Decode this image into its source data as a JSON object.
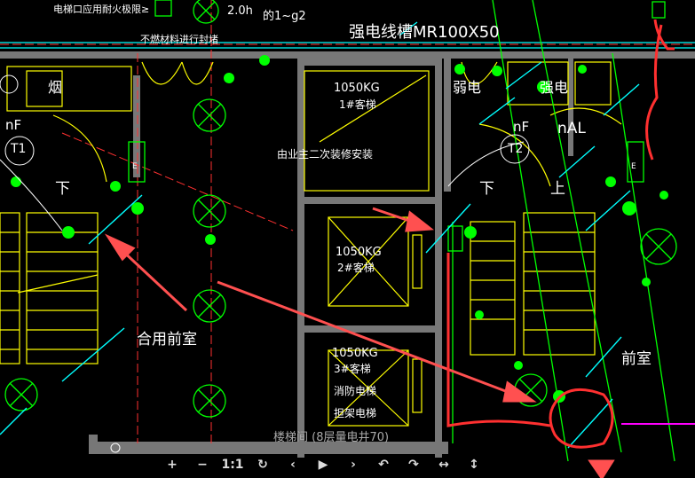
{
  "drawing": {
    "top_note": "电梯口应用耐火极限≥",
    "top_value": "2.0h",
    "top_code": "的1~g2",
    "cable_tray_label": "强电线槽MR100X50",
    "fire_seal_note": "不燃材料进行封堵",
    "smoke_label": "烟",
    "left_box_label": "nF",
    "left_stair_label": "T1",
    "right_stair_label": "T2",
    "right_elec_label": "弱电",
    "right_strong_label": "强电",
    "right_nf_label": "nF",
    "right_nal_label": "nAL",
    "down_left": "下",
    "down_right": "下",
    "up_right": "上",
    "e_tag": "E",
    "elevator1_capacity": "1050KG",
    "elevator1_name": "1#客梯",
    "elevator1_note": "由业主二次装修安装",
    "elevator2_capacity": "1050KG",
    "elevator2_name": "2#客梯",
    "elevator3_capacity": "1050KG",
    "elevator3_name": "3#客梯",
    "elevator3_fire": "消防电梯",
    "elevator3_extra": "担架电梯",
    "shared_anteroom": "合用前室",
    "anteroom": "前室",
    "stairwell": "楼梯间",
    "footer_label": "楼梯间 (8层量电井70)"
  },
  "toolbar": {
    "zoom_in": "+",
    "zoom_out": "−",
    "actual_size": "1:1",
    "rotate": "↻",
    "prev": "‹",
    "play": "▶",
    "next": "›",
    "undo": "↶",
    "redo": "↷",
    "flip_h": "↔",
    "flip_v": "↕"
  },
  "colors": {
    "background": "#000000",
    "wall": "#888888",
    "red_line": "#ff3030",
    "yellow": "#ffff00",
    "green": "#00ff00",
    "cyan": "#00ffff",
    "white": "#ffffff",
    "annotation_arrow": "#ff5050"
  }
}
